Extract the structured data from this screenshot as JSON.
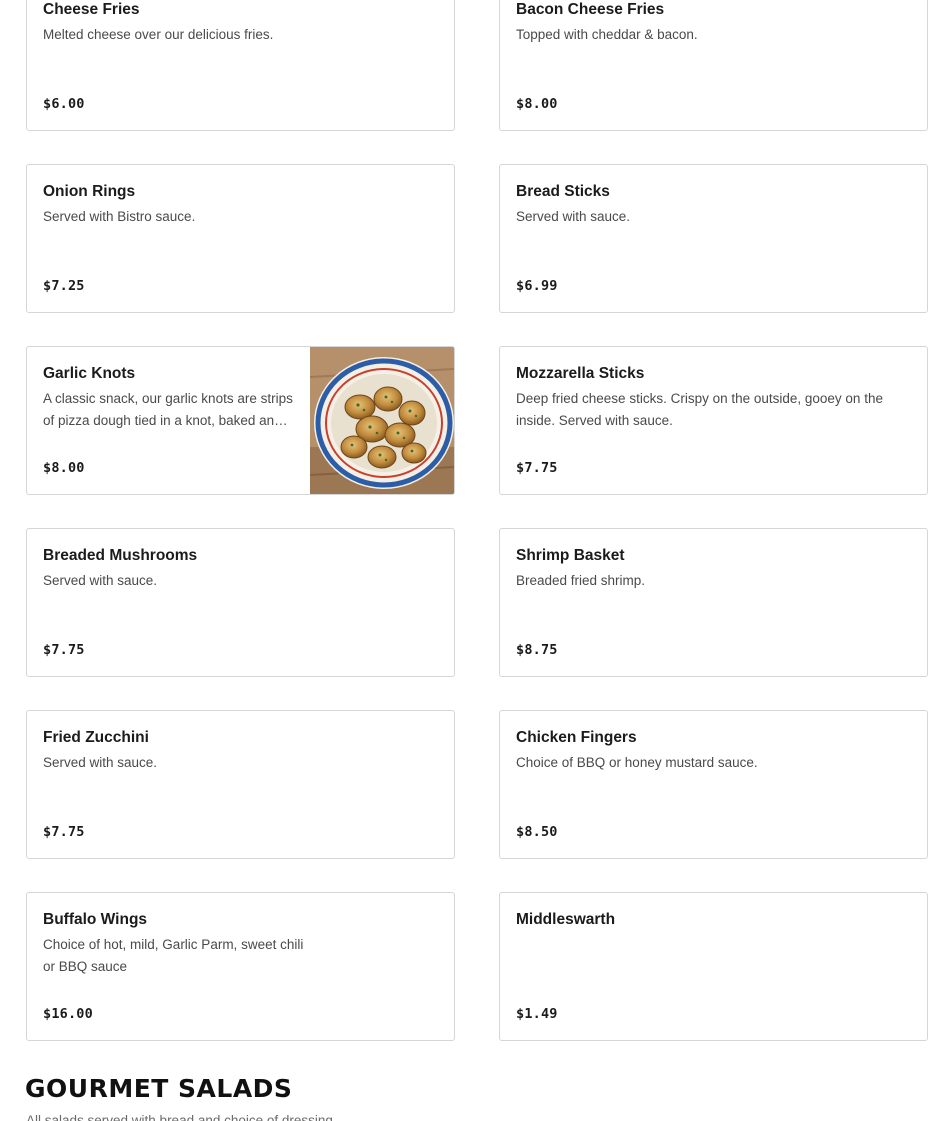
{
  "menu": {
    "items": [
      {
        "name": "Cheese Fries",
        "description": "Melted cheese over our delicious fries.",
        "price": "$6.00",
        "has_photo": false
      },
      {
        "name": "Bacon Cheese Fries",
        "description": "Topped with cheddar & bacon.",
        "price": "$8.00",
        "has_photo": false
      },
      {
        "name": "Onion Rings",
        "description": "Served with Bistro sauce.",
        "price": "$7.25",
        "has_photo": false
      },
      {
        "name": "Bread Sticks",
        "description": "Served with sauce.",
        "price": "$6.99",
        "has_photo": false
      },
      {
        "name": "Garlic Knots",
        "description": "A classic snack, our garlic knots are strips of pizza dough tied in a knot, baked and tossed in garlic butter.",
        "price": "$8.00",
        "has_photo": true
      },
      {
        "name": "Mozzarella Sticks",
        "description": "Deep fried cheese sticks. Crispy on the outside, gooey on the inside. Served with sauce.",
        "price": "$7.75",
        "has_photo": false
      },
      {
        "name": "Breaded Mushrooms",
        "description": "Served with sauce.",
        "price": "$7.75",
        "has_photo": false
      },
      {
        "name": "Shrimp Basket",
        "description": "Breaded fried shrimp.",
        "price": "$8.75",
        "has_photo": false
      },
      {
        "name": "Fried Zucchini",
        "description": "Served with sauce.",
        "price": "$7.75",
        "has_photo": false
      },
      {
        "name": "Chicken Fingers",
        "description": "Choice of BBQ or honey mustard sauce.",
        "price": "$8.50",
        "has_photo": false
      },
      {
        "name": "Buffalo Wings",
        "description": "Choice of hot, mild, Garlic Parm, sweet chili or BBQ sauce",
        "price": "$16.00",
        "has_photo": false
      },
      {
        "name": "Middleswarth",
        "description": "",
        "price": "$1.49",
        "has_photo": false
      }
    ]
  },
  "next_section": {
    "title": "GOURMET SALADS",
    "subtitle": "All salads served with bread and choice of dressing."
  },
  "colors": {
    "border": "#d6d6d6",
    "text": "#1b1b1b",
    "muted": "#4a4a4a"
  }
}
